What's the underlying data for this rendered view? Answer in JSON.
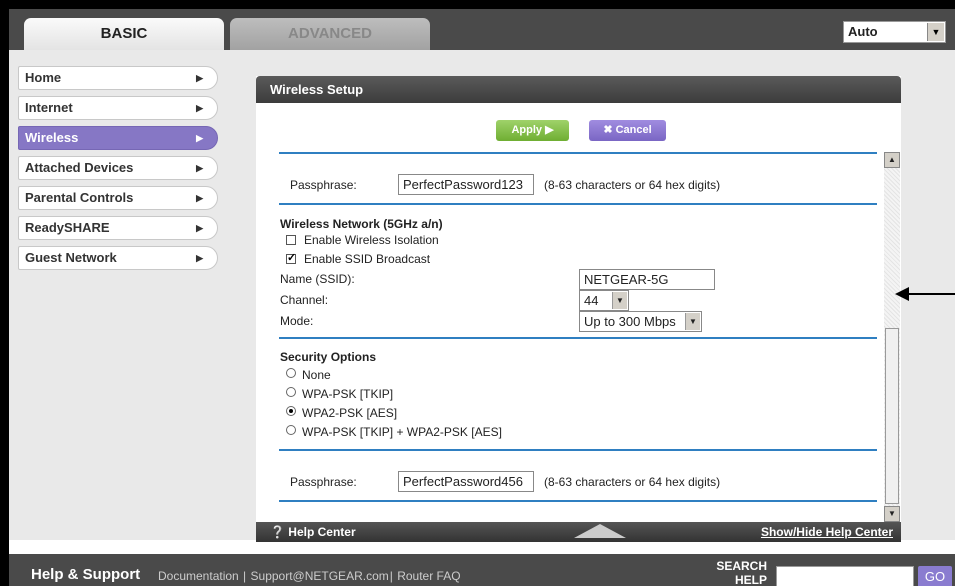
{
  "tabs": {
    "basic": "BASIC",
    "advanced": "ADVANCED"
  },
  "language_select": {
    "value": "Auto"
  },
  "sidebar": {
    "items": [
      {
        "label": "Home"
      },
      {
        "label": "Internet"
      },
      {
        "label": "Wireless"
      },
      {
        "label": "Attached Devices"
      },
      {
        "label": "Parental Controls"
      },
      {
        "label": "ReadySHARE"
      },
      {
        "label": "Guest Network"
      }
    ]
  },
  "panel": {
    "title": "Wireless Setup",
    "apply_label": "Apply ▶",
    "cancel_label": "✖ Cancel"
  },
  "passphrase_24": {
    "label": "Passphrase:",
    "value": "PerfectPassword123",
    "hint": "(8-63 characters or 64 hex digits)"
  },
  "network_5g": {
    "heading": "Wireless Network (5GHz a/n)",
    "isolation_label": "Enable Wireless Isolation",
    "isolation_checked": false,
    "ssid_broadcast_label": "Enable SSID Broadcast",
    "ssid_broadcast_checked": true,
    "name_label": "Name (SSID):",
    "name_value": "NETGEAR-5G",
    "channel_label": "Channel:",
    "channel_value": "44",
    "mode_label": "Mode:",
    "mode_value": "Up to 300 Mbps"
  },
  "security": {
    "heading": "Security Options",
    "options": [
      {
        "label": "None",
        "selected": false
      },
      {
        "label": "WPA-PSK [TKIP]",
        "selected": false
      },
      {
        "label": "WPA2-PSK [AES]",
        "selected": true
      },
      {
        "label": "WPA-PSK [TKIP] + WPA2-PSK [AES]",
        "selected": false
      }
    ]
  },
  "passphrase_5g": {
    "label": "Passphrase:",
    "value": "PerfectPassword456",
    "hint": "(8-63 characters or 64 hex digits)"
  },
  "help_bar": {
    "help_center": "Help Center",
    "show_hide": "Show/Hide Help Center"
  },
  "footer": {
    "title": "Help & Support",
    "links": [
      "Documentation",
      "Support@NETGEAR.com",
      "Router FAQ"
    ],
    "search_label_line1": "SEARCH",
    "search_label_line2": "HELP",
    "go_label": "GO"
  },
  "icons": {
    "help": "question-circle-icon",
    "nav_chevron": "chevron-right-icon",
    "dropdown": "chevron-down-icon",
    "pointer": "arrow-left-icon"
  },
  "colors": {
    "accent_purple": "#8677c5",
    "apply_green": "#6fae32",
    "rule_blue": "#2f7fc1",
    "header_dark": "#4a4a4a"
  }
}
